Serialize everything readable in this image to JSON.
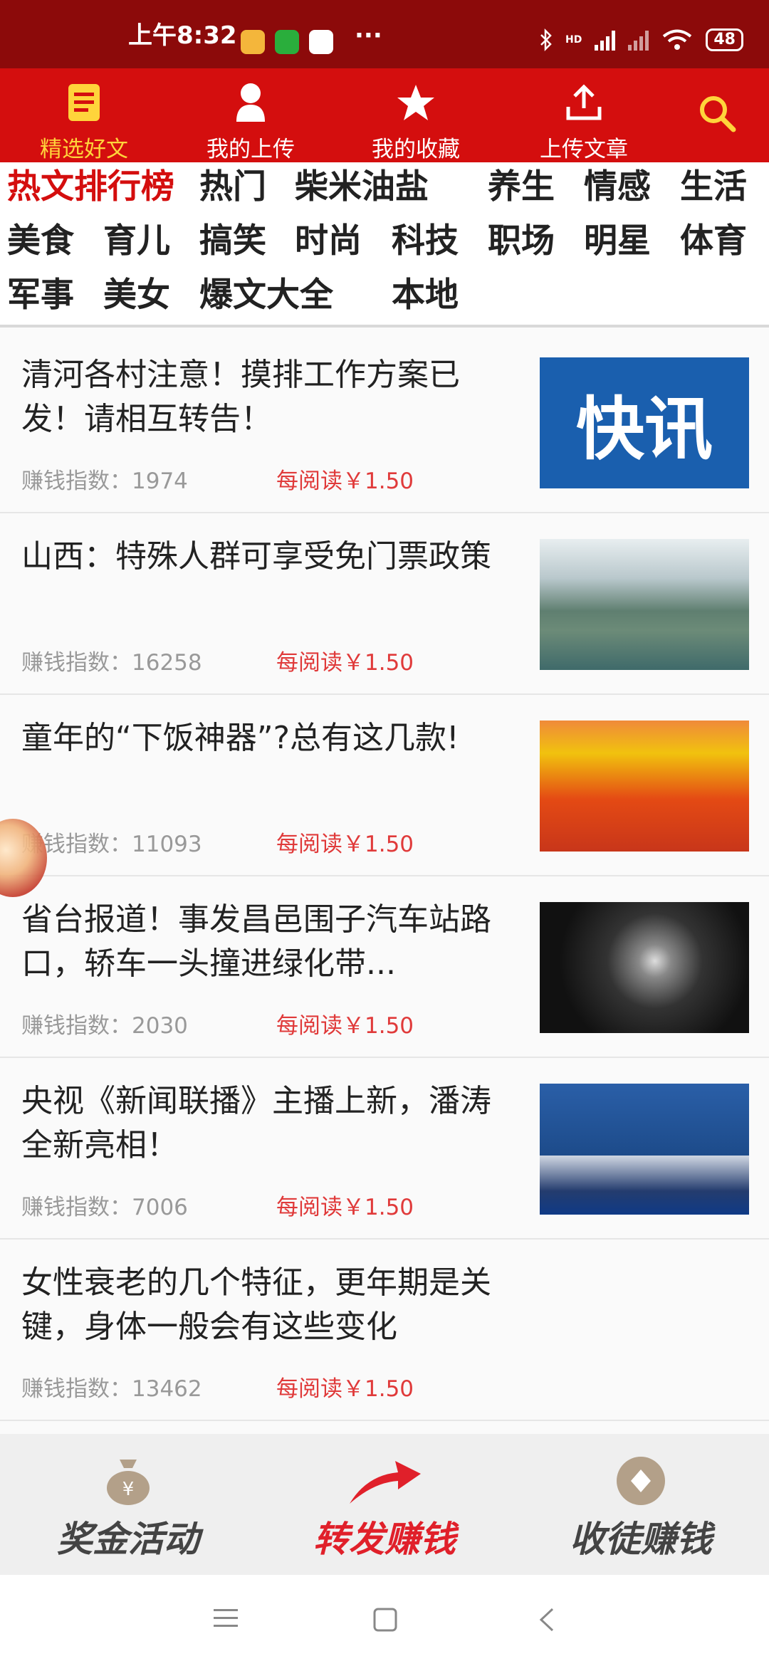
{
  "status_bar": {
    "time": "上午8:32",
    "dots": "···",
    "battery": "48",
    "network": "HD"
  },
  "top_nav": [
    {
      "label": "精选好文",
      "icon": "document-icon",
      "active": true
    },
    {
      "label": "我的上传",
      "icon": "user-icon",
      "active": false
    },
    {
      "label": "我的收藏",
      "icon": "star-icon",
      "active": false
    },
    {
      "label": "上传文章",
      "icon": "upload-icon",
      "active": false
    }
  ],
  "categories": [
    "热文排行榜",
    "热门",
    "柴米油盐",
    "养生",
    "情感",
    "生活",
    "美食",
    "育儿",
    "搞笑",
    "时尚",
    "科技",
    "职场",
    "明星",
    "体育",
    "军事",
    "美女",
    "爆文大全",
    "本地"
  ],
  "articles": [
    {
      "title": "清河各村注意！摸排工作方案已发！请相互转告！",
      "index_label": "赚钱指数：",
      "index": "1974",
      "reward": "每阅读￥1.50",
      "thumb_text": "快讯"
    },
    {
      "title": "山西：特殊人群可享受免门票政策",
      "index_label": "赚钱指数：",
      "index": "16258",
      "reward": "每阅读￥1.50"
    },
    {
      "title": "童年的“下饭神器”?总有这几款!",
      "index_label": "赚钱指数：",
      "index": "11093",
      "reward": "每阅读￥1.50"
    },
    {
      "title": "省台报道！事发昌邑围子汽车站路口，轿车一头撞进绿化带...",
      "index_label": "赚钱指数：",
      "index": "2030",
      "reward": "每阅读￥1.50"
    },
    {
      "title": "央视《新闻联播》主播上新，潘涛全新亮相！",
      "index_label": "赚钱指数：",
      "index": "7006",
      "reward": "每阅读￥1.50"
    },
    {
      "title": "女性衰老的几个特征，更年期是关键，身体一般会有这些变化",
      "index_label": "赚钱指数：",
      "index": "13462",
      "reward": "每阅读￥1.50"
    }
  ],
  "actions": [
    {
      "label": "奖金活动",
      "icon": "money-bag-icon"
    },
    {
      "label": "转发赚钱",
      "icon": "share-arrow-icon"
    },
    {
      "label": "收徒赚钱",
      "icon": "diamond-coin-icon"
    }
  ],
  "colors": {
    "brand_red": "#d40e0e",
    "status_red": "#8c0a0a",
    "active_yellow": "#ffd43b",
    "reward_red": "#e03a3a"
  }
}
